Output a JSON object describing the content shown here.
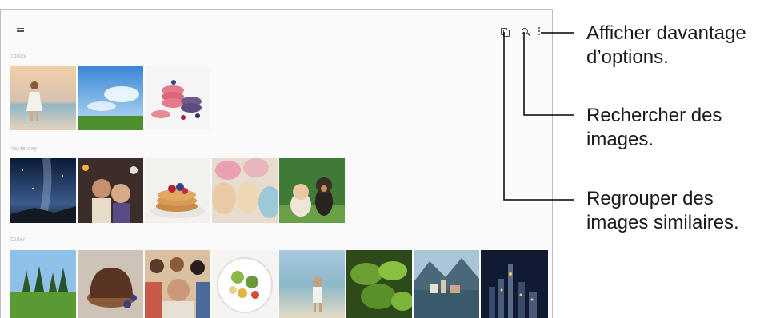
{
  "toolbar": {
    "menu_icon": "hamburger-menu-icon",
    "icons": [
      "group-similar-icon",
      "search-icon",
      "more-options-icon"
    ]
  },
  "sections": [
    {
      "label": "Today",
      "thumbs": [
        "girl-on-beach",
        "blue-sky-field",
        "macarons-berries"
      ]
    },
    {
      "label": "Yesterday",
      "thumbs": [
        "milky-way-night",
        "party-selfie",
        "pancakes-berries",
        "pastel-macarons",
        "kitten-and-puppy"
      ]
    },
    {
      "label": "Older",
      "thumbs": [
        "green-park-trees",
        "chocolate-cake",
        "group-selfie",
        "salad-plate",
        "child-on-beach",
        "green-leaves",
        "lake-village",
        "city-night"
      ]
    }
  ],
  "callouts": {
    "more": {
      "line1": "Afficher davantage",
      "line2": "d’options."
    },
    "search": {
      "line1": "Rechercher des",
      "line2": "images."
    },
    "group": {
      "line1": "Regrouper des",
      "line2": "images similaires."
    }
  },
  "colors": {
    "screen_bg": "#fafafa",
    "border": "#bfbfbf",
    "callout_line": "#000000"
  }
}
